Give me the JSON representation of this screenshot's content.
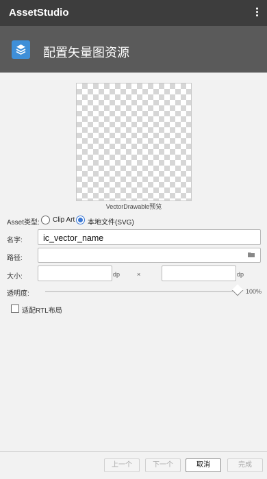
{
  "appbar": {
    "title": "AssetStudio",
    "menu_icon": "more-vertical-icon"
  },
  "header": {
    "title": "配置矢量图资源",
    "icon": "layers-icon",
    "icon_color": "#3f8fd8"
  },
  "preview": {
    "caption": "VectorDrawable预览"
  },
  "asset_type": {
    "label": "Asset类型:",
    "options": [
      {
        "label": "Clip Art",
        "selected": false
      },
      {
        "label": "本地文件(SVG)",
        "selected": true
      }
    ]
  },
  "name": {
    "label": "名字:",
    "value": "ic_vector_name"
  },
  "path": {
    "label": "路径:",
    "value": "",
    "icon": "folder-icon"
  },
  "size": {
    "label": "大小:",
    "width": "",
    "height": "",
    "unit": "dp",
    "separator": "×"
  },
  "opacity": {
    "label": "透明度:",
    "value_text": "100%",
    "value": 1.0
  },
  "rtl": {
    "label": "适配RTL布局",
    "checked": false
  },
  "footer": {
    "prev": "上一个",
    "next": "下一个",
    "cancel": "取消",
    "finish": "完成"
  },
  "colors": {
    "appbar": "#3d3d3d",
    "header": "#5a5a5a",
    "accent": "#3b78d4"
  }
}
